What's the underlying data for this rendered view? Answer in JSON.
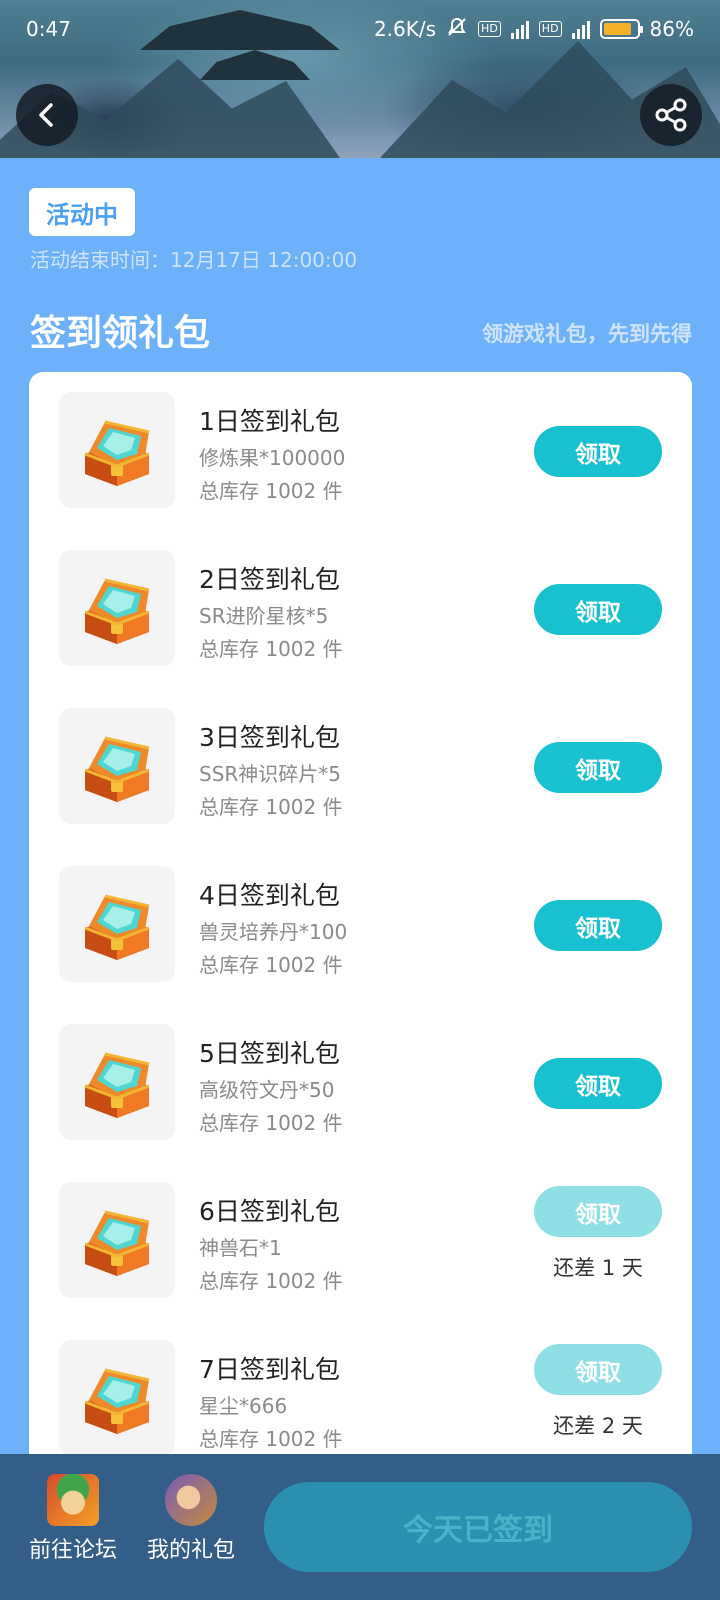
{
  "status_bar": {
    "time": "0:47",
    "net_speed": "2.6K/s",
    "hd1": "HD",
    "hd2": "HD",
    "battery": "86%"
  },
  "header": {
    "back_icon": "chevron-left-icon",
    "share_icon": "share-icon"
  },
  "activity": {
    "status": "活动中",
    "end_time": "活动结束时间：12月17日 12:00:00"
  },
  "section": {
    "title": "签到领礼包",
    "subtitle": "领游戏礼包，先到先得"
  },
  "gifts": [
    {
      "name": "1日签到礼包",
      "content": "修炼果*100000",
      "stock": "总库存 1002 件",
      "button": "领取",
      "remain": ""
    },
    {
      "name": "2日签到礼包",
      "content": "SR进阶星核*5",
      "stock": "总库存 1002 件",
      "button": "领取",
      "remain": ""
    },
    {
      "name": "3日签到礼包",
      "content": "SSR神识碎片*5",
      "stock": "总库存 1002 件",
      "button": "领取",
      "remain": ""
    },
    {
      "name": "4日签到礼包",
      "content": "兽灵培养丹*100",
      "stock": "总库存 1002 件",
      "button": "领取",
      "remain": ""
    },
    {
      "name": "5日签到礼包",
      "content": "高级符文丹*50",
      "stock": "总库存 1002 件",
      "button": "领取",
      "remain": ""
    },
    {
      "name": "6日签到礼包",
      "content": "神兽石*1",
      "stock": "总库存 1002 件",
      "button": "领取",
      "remain": "还差 1 天"
    },
    {
      "name": "7日签到礼包",
      "content": "星尘*666",
      "stock": "总库存 1002 件",
      "button": "领取",
      "remain": "还差 2 天"
    }
  ],
  "bottom": {
    "forum_label": "前往论坛",
    "my_gifts_label": "我的礼包",
    "signed_label": "今天已签到"
  },
  "colors": {
    "background": "#6db1fa",
    "claim_active": "#18c1cf",
    "claim_disabled": "#8fdfe6",
    "bottom_bar": "#325e88"
  }
}
